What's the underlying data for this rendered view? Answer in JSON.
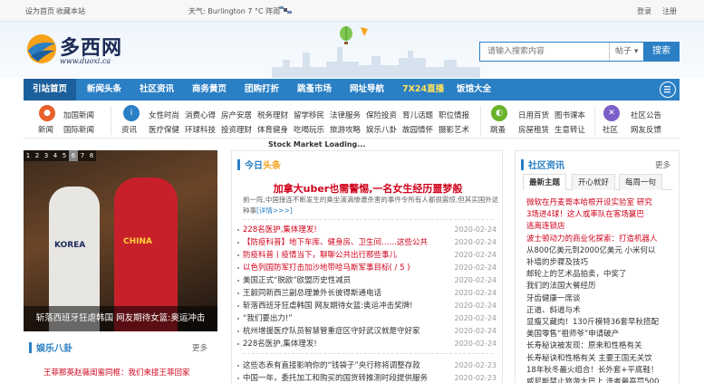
{
  "topbar": {
    "set_home": "设为首页",
    "bookmark": "收藏本站",
    "weather": "天气: Burlington 7 °C 阵雨",
    "login": "登录",
    "register": "注册"
  },
  "logo": {
    "text": "多西网",
    "sub": "www.duoxi.ca"
  },
  "search": {
    "placeholder": "请输入搜索内容",
    "scope": "帖子",
    "button": "搜索"
  },
  "nav": {
    "items": [
      "引站首页",
      "新闻头条",
      "社区资讯",
      "商务黄页",
      "团购打折",
      "跳蚤市场",
      "网址导航",
      "7X24直播",
      "饭馆大全"
    ]
  },
  "categories": {
    "news": {
      "icon_label": "新闻",
      "row1": [
        "加国新闻"
      ],
      "row2": [
        "国际新闻"
      ]
    },
    "info": {
      "icon_label": "资讯",
      "row1": [
        "女性时尚",
        "消费心得",
        "房产安居",
        "税务理财",
        "留学移民",
        "法律服务",
        "保险投资",
        "育儿话题",
        "职位情报"
      ],
      "row2": [
        "医疗保健",
        "环球科技",
        "投资理财",
        "体育健身",
        "吃喝玩乐",
        "旅游攻略",
        "娱乐八卦",
        "故园情怀",
        "摄影艺术"
      ]
    },
    "market": {
      "icon_label": "跳蚤",
      "row1": [
        "日用百货",
        "图书课本"
      ],
      "row2": [
        "房屋租赁",
        "生意转让"
      ]
    },
    "community": {
      "icon_label": "社区",
      "row1": [
        "社区公告"
      ],
      "row2": [
        "网友反馈"
      ]
    }
  },
  "ticker": "Stock Market Loading...",
  "slider": {
    "pages": [
      "1",
      "2",
      "3",
      "4",
      "5",
      "6",
      "7",
      "8"
    ],
    "active_page": "6",
    "jersey_left": "KOREA",
    "jersey_right": "CHINA",
    "caption": "斩落西班牙狂虐韩国 网友期待女篮:奥运冲击"
  },
  "entertainment": {
    "title": "娱乐八卦",
    "more": "更多",
    "items": [
      "王菲那英赵薇闺蜜同框：我们来接王菲回家"
    ]
  },
  "today": {
    "title_blue": "今日",
    "title_red": "头条",
    "headline": "加拿大uber也需警惕,一名女生经历噩梦般",
    "summary": "前一阵,中国接连不断发生的乘坐滴滴惨遭杀害的事件令所有人都很震惊,但其实国外这种事",
    "detail": "[详情>>>]",
    "items": [
      {
        "text": "228名医护,集体理发!",
        "date": "2020-02-24",
        "red": true
      },
      {
        "text": "【防疫科普】地下车库、健身房、卫生间……这些公共",
        "date": "2020-02-24",
        "red": true
      },
      {
        "text": "防疫科普丨疫情当下，聊聊公共出行那些事儿",
        "date": "2020-02-24",
        "red": true
      },
      {
        "text": "以色列国防军打击加沙地带哈马斯军事目标( / 5 )",
        "date": "2020-02-24",
        "red": true
      },
      {
        "text": "美国正式“脱欧”欧盟历史性减员",
        "date": "2020-02-24",
        "red": false
      },
      {
        "text": "王毅同新西兰副总理兼外长彼得斯通电话",
        "date": "2020-02-24",
        "red": false
      },
      {
        "text": "斩落西班牙狂虐韩国 网友期待女篮:奥运冲击奖牌!",
        "date": "2020-02-24",
        "red": false
      },
      {
        "text": "“我们要出力!”",
        "date": "2020-02-24",
        "red": false
      },
      {
        "text": "杭州增援医疗队员智慧管重症区守好武汉就是守好家",
        "date": "2020-02-24",
        "red": false
      },
      {
        "text": "228名医护,集体理发!",
        "date": "2020-02-24",
        "red": false
      },
      {
        "text": "这些态表有直接影响你的“钱袋子”央行称将调整存款",
        "date": "2020-02-23",
        "red": false
      },
      {
        "text": "中国一年，委托加工和购买的国货转推测时段提供服务",
        "date": "2020-02-23",
        "red": false
      }
    ]
  },
  "community": {
    "title": "社区资讯",
    "more": "更多",
    "tabs": [
      "最新主题",
      "开心就好",
      "每周一句"
    ],
    "items": [
      {
        "text": "微软在丹麦哥本哈根开设实验室 研究",
        "red": true
      },
      {
        "text": "3场进4球！这人或率队在客场赢巴",
        "red": true
      },
      {
        "text": "逃离连锁店",
        "red": true
      },
      {
        "text": "波士顿动力的商业化探索：打造机器人",
        "red": true
      },
      {
        "text": "从800亿美元到2000亿美元 小米何以",
        "red": false
      },
      {
        "text": "补墙的步骤及技巧",
        "red": false
      },
      {
        "text": "邮轮上的艺术品拍卖，中奖了",
        "red": false
      },
      {
        "text": "我们的法国大餐经历",
        "red": false
      },
      {
        "text": "牙齿健康一席谈",
        "red": false
      },
      {
        "text": "正道、斜道与术",
        "red": false
      },
      {
        "text": "显瘦又藏肉！130斤模特36套早秋搭配",
        "red": false
      },
      {
        "text": "美国零售“祖师爷”申请破产",
        "red": false
      },
      {
        "text": "长寿秘诀被发现：原来和性格有关",
        "red": false
      },
      {
        "text": "长寿秘诀和性格有关 主要王国无关饮",
        "red": false
      },
      {
        "text": "18年秋冬最火组合！长外套+平底鞋！",
        "red": false
      },
      {
        "text": "威尼斯禁止旅游大巴上 洗者最高罚500",
        "red": false
      }
    ]
  },
  "colors": {
    "brand_blue": "#2a7fc5",
    "headline_red": "#d0021b",
    "live_yellow": "#ffe35a"
  }
}
